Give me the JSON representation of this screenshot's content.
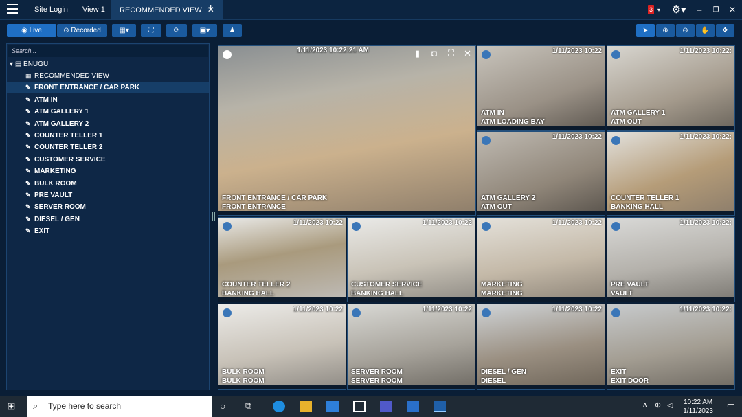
{
  "tabs": [
    {
      "label": "Site Login"
    },
    {
      "label": "View 1"
    },
    {
      "label": "RECOMMENDED VIEW"
    }
  ],
  "header": {
    "notification_count": "3"
  },
  "toolbar": {
    "live_label": "Live",
    "recorded_label": "Recorded"
  },
  "sidebar": {
    "search_placeholder": "Search...",
    "root": "ENUGU",
    "items": [
      {
        "label": "RECOMMENDED VIEW"
      },
      {
        "label": "FRONT ENTRANCE / CAR PARK"
      },
      {
        "label": "ATM IN"
      },
      {
        "label": "ATM GALLERY 1"
      },
      {
        "label": "ATM GALLERY 2"
      },
      {
        "label": "COUNTER TELLER 1"
      },
      {
        "label": "COUNTER TELLER 2"
      },
      {
        "label": "CUSTOMER SERVICE"
      },
      {
        "label": "MARKETING"
      },
      {
        "label": "BULK ROOM"
      },
      {
        "label": "PRE VAULT"
      },
      {
        "label": "SERVER ROOM"
      },
      {
        "label": "DIESEL / GEN"
      },
      {
        "label": "EXIT"
      }
    ]
  },
  "tiles": [
    {
      "ts": "1/11/2023 10:22:21 AM",
      "l1": "FRONT ENTRANCE / CAR PARK",
      "l2": "FRONT ENTRANCE"
    },
    {
      "ts": "1/11/2023 10:22",
      "l1": "ATM IN",
      "l2": "ATM LOADING BAY"
    },
    {
      "ts": "1/11/2023 10:22:",
      "l1": "ATM GALLERY 1",
      "l2": "ATM OUT"
    },
    {
      "ts": "1/11/2023 10:22",
      "l1": "ATM GALLERY 2",
      "l2": "ATM OUT"
    },
    {
      "ts": "1/11/2023 10:22:",
      "l1": "COUNTER TELLER 1",
      "l2": "BANKING HALL"
    },
    {
      "ts": "1/11/2023 10:22",
      "l1": "COUNTER TELLER 2",
      "l2": "BANKING HALL"
    },
    {
      "ts": "1/11/2023 10:22",
      "l1": "CUSTOMER SERVICE",
      "l2": "BANKING HALL"
    },
    {
      "ts": "1/11/2023 10:22",
      "l1": "MARKETING",
      "l2": "MARKETING"
    },
    {
      "ts": "1/11/2023 10:22:",
      "l1": "PRE VAULT",
      "l2": "VAULT"
    },
    {
      "ts": "1/11/2023 10:22",
      "l1": "BULK ROOM",
      "l2": "BULK ROOM"
    },
    {
      "ts": "1/11/2023 10:22",
      "l1": "SERVER ROOM",
      "l2": "SERVER ROOM"
    },
    {
      "ts": "1/11/2023 10:22",
      "l1": "DIESEL / GEN",
      "l2": "DIESEL"
    },
    {
      "ts": "1/11/2023 10:22:",
      "l1": "EXIT",
      "l2": "EXIT DOOR"
    }
  ],
  "taskbar": {
    "search_placeholder": "Type here to search",
    "time": "10:22 AM",
    "date": "1/11/2023"
  }
}
